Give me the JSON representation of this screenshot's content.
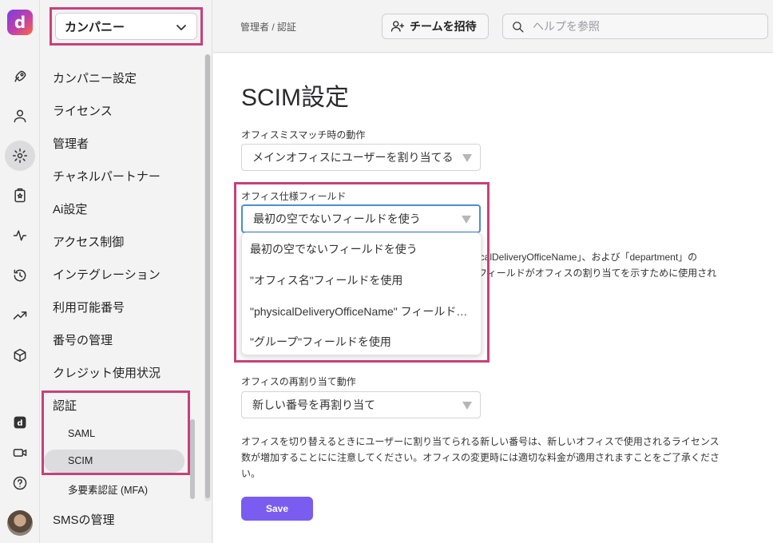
{
  "app": {
    "logo_letter": "d",
    "brand_color": "#7b3fe4"
  },
  "rail": {
    "icons": [
      "rocket-icon",
      "user-icon",
      "gear-icon",
      "clipboard-icon",
      "activity-icon",
      "history-icon",
      "trending-icon",
      "cube-icon",
      "dialpad-app-icon",
      "video-icon",
      "help-icon"
    ],
    "active_icon": "gear-icon"
  },
  "sidebar": {
    "company_select": "カンパニー",
    "items": [
      {
        "label": "カンパニー設定"
      },
      {
        "label": "ライセンス"
      },
      {
        "label": "管理者"
      },
      {
        "label": "チャネルパートナー"
      },
      {
        "label": "Ai設定"
      },
      {
        "label": "アクセス制御"
      },
      {
        "label": "インテグレーション"
      },
      {
        "label": "利用可能番号"
      },
      {
        "label": "番号の管理"
      },
      {
        "label": "クレジット使用状況"
      },
      {
        "label": "認証"
      },
      {
        "label": "SAML"
      },
      {
        "label": "SCIM"
      },
      {
        "label": "多要素認証 (MFA)"
      },
      {
        "label": "SMSの管理"
      }
    ],
    "selected": "SCIM",
    "highlight_color": "#c8407a"
  },
  "topbar": {
    "breadcrumb": "管理者 / 認証",
    "invite_label": "チームを招待",
    "search_placeholder": "ヘルプを参照"
  },
  "main": {
    "title": "SCIM設定",
    "mismatch_label": "オフィスミスマッチ時の動作",
    "mismatch_value": "メインオフィスにユーザーを割り当てる",
    "field_label": "オフィス仕様フィールド",
    "field_value": "最初の空でないフィールドを使う",
    "field_options": [
      "最初の空でないフィールドを使う",
      "\"オフィス名\"フィールドを使用",
      "\"physicalDeliveryOfficeName\" フィールドを使用",
      "\"グループ\"フィールドを使用"
    ],
    "hidden_desc_line1": "icalDeliveryOfficeName」、および「department」の",
    "hidden_desc_line2": "フィールドがオフィスの割り当てを示すために使用され",
    "reassign_label": "オフィスの再割り当て動作",
    "reassign_value": "新しい番号を再割り当て",
    "reassign_desc": "オフィスを切り替えるときにユーザーに割り当てられる新しい番号は、新しいオフィスで使用されるライセンス数が増加することにに注意してください。オフィスの変更時には適切な料金が適用されますことをご了承ください。",
    "save_label": "Save",
    "save_color": "#7b5cf0"
  }
}
